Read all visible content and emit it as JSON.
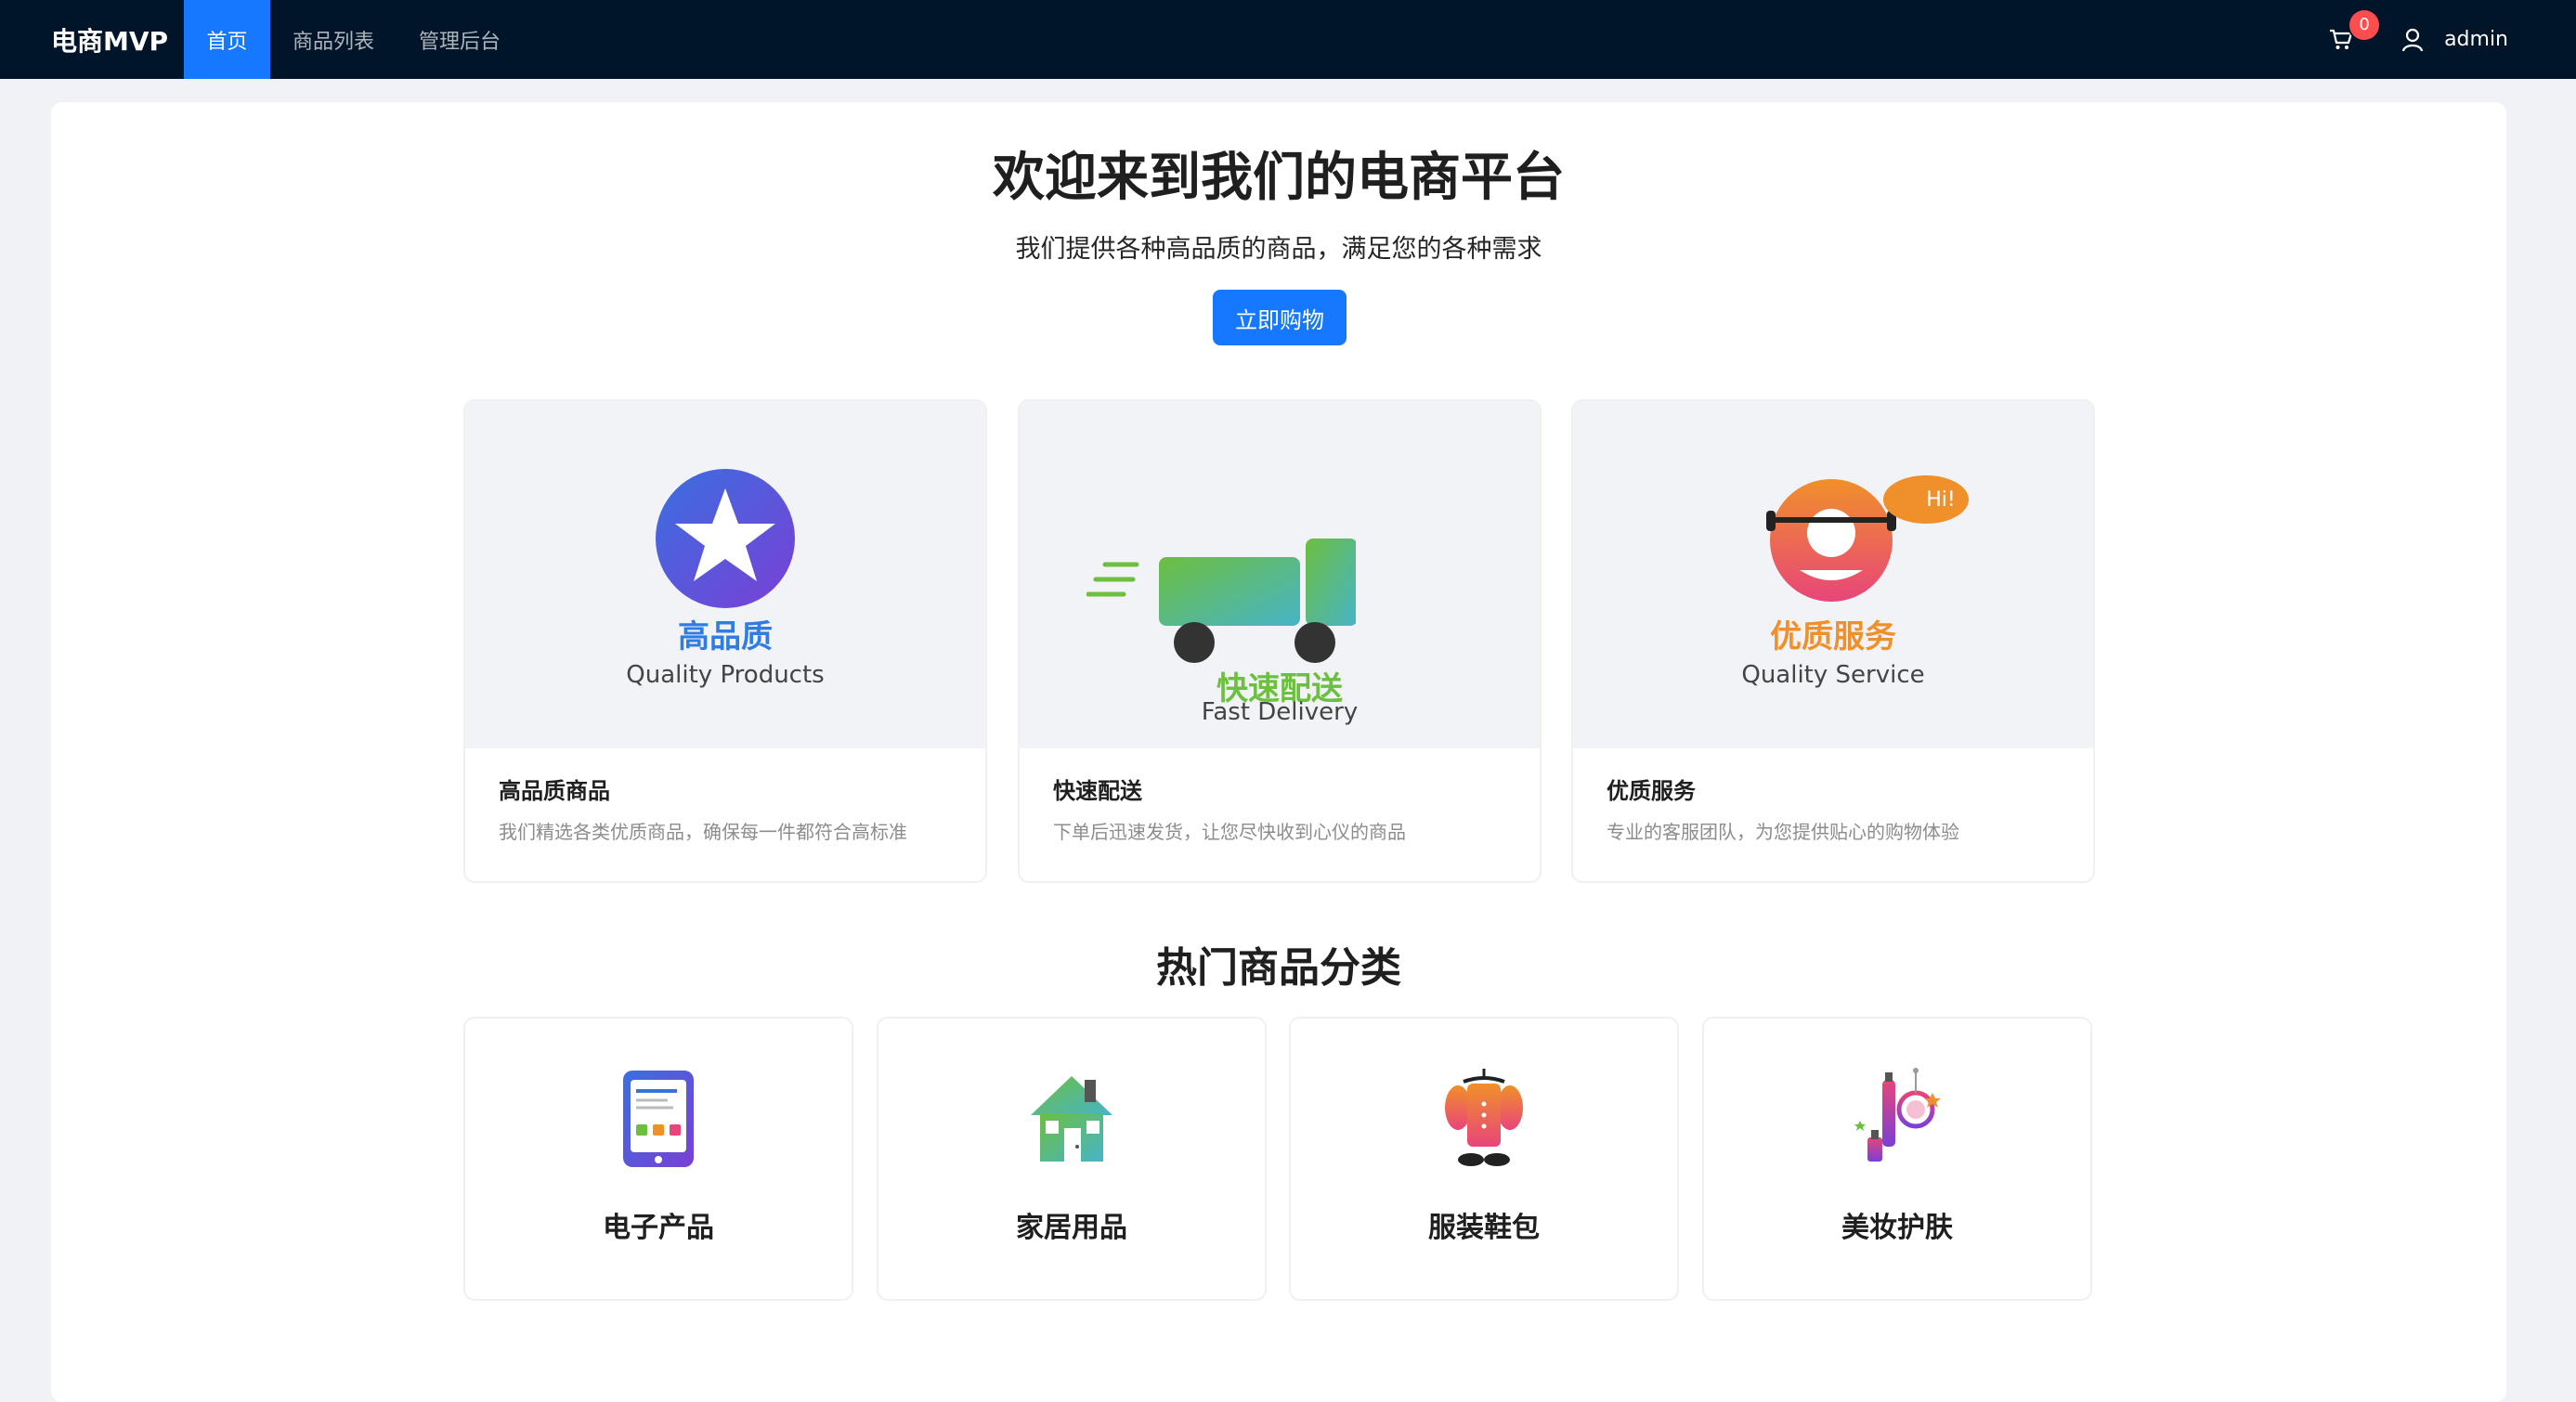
{
  "nav": {
    "brand": "电商MVP",
    "items": [
      {
        "label": "首页",
        "active": true
      },
      {
        "label": "商品列表",
        "active": false
      },
      {
        "label": "管理后台",
        "active": false
      }
    ],
    "cart_icon": "cart-icon",
    "cart_count": "0",
    "user_icon": "user-icon",
    "username": "admin"
  },
  "hero": {
    "title": "欢迎来到我们的电商平台",
    "subtitle": "我们提供各种高品质的商品，满足您的各种需求",
    "cta_label": "立即购物"
  },
  "features": [
    {
      "art_cn": "高品质",
      "art_en": "Quality Products",
      "title": "高品质商品",
      "desc": "我们精选各类优质商品，确保每一件都符合高标准",
      "icon": "star-icon"
    },
    {
      "art_cn": "快速配送",
      "art_en": "Fast Delivery",
      "title": "快速配送",
      "desc": "下单后迅速发货，让您尽快收到心仪的商品",
      "icon": "truck-icon"
    },
    {
      "art_cn": "优质服务",
      "art_en": "Quality Service",
      "art_bubble": "Hi!",
      "title": "优质服务",
      "desc": "专业的客服团队，为您提供贴心的购物体验",
      "icon": "support-icon"
    }
  ],
  "categories_title": "热门商品分类",
  "categories": [
    {
      "name": "电子产品",
      "icon": "tablet-icon"
    },
    {
      "name": "家居用品",
      "icon": "house-icon"
    },
    {
      "name": "服装鞋包",
      "icon": "clothing-icon"
    },
    {
      "name": "美妆护肤",
      "icon": "cosmetics-icon"
    }
  ],
  "colors": {
    "nav_bg": "#001529",
    "primary": "#1677ff",
    "badge": "#ff4d4f",
    "quality_blue": "#2f7de1",
    "delivery_green": "#6cbf3f",
    "service_orange": "#f0902a"
  }
}
